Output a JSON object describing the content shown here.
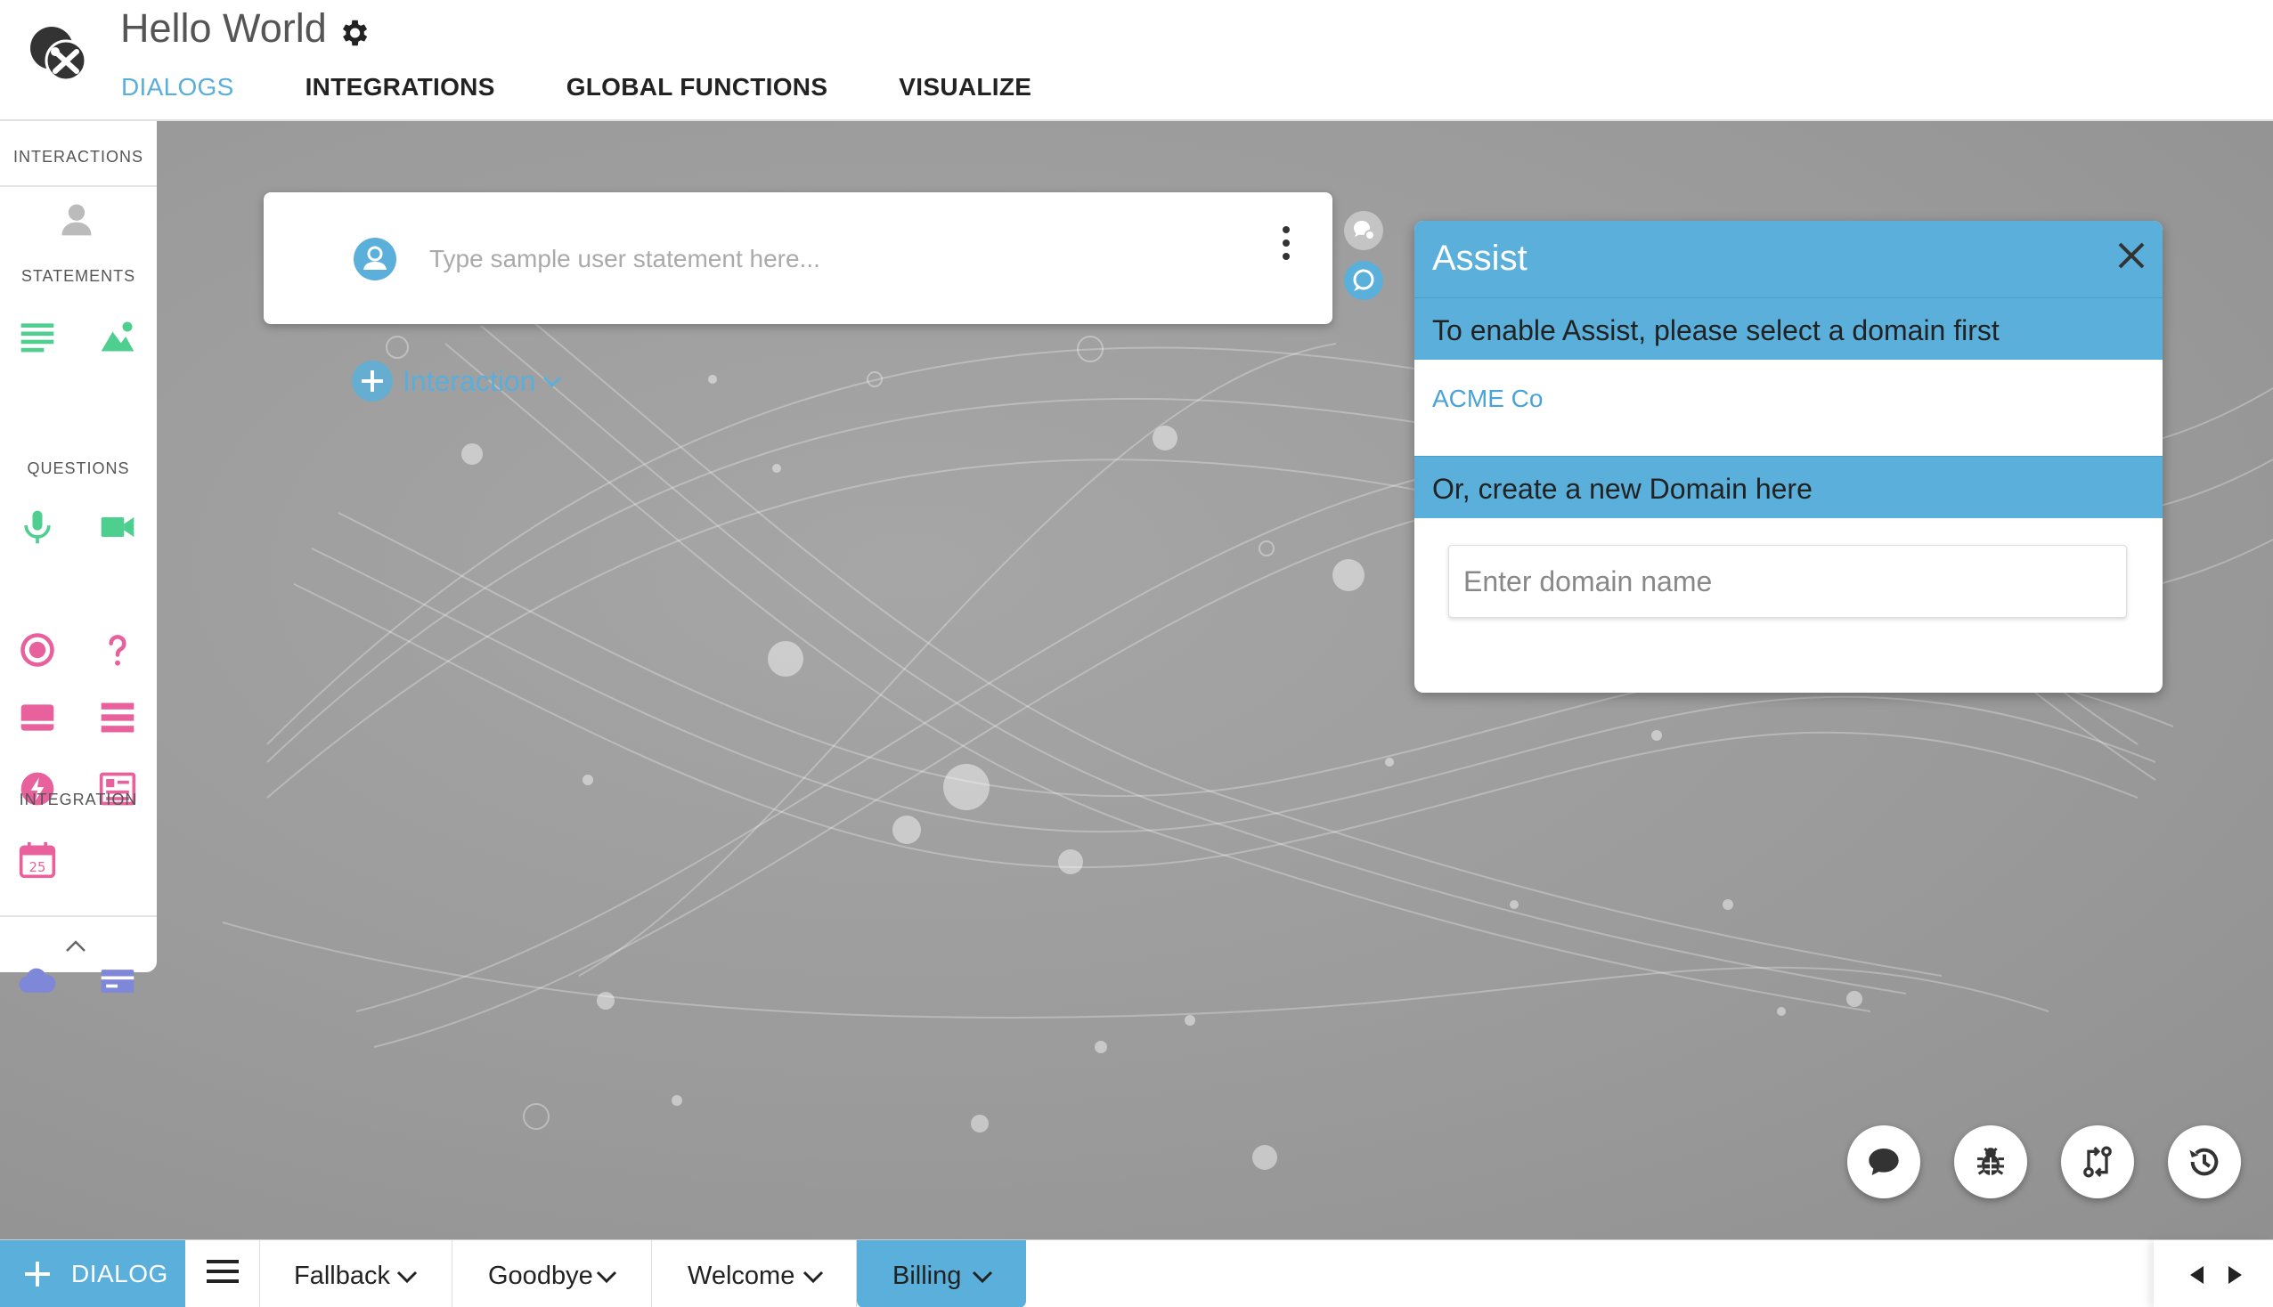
{
  "header": {
    "title": "Hello World",
    "tabs": [
      {
        "label": "DIALOGS",
        "active": true
      },
      {
        "label": "INTEGRATIONS",
        "active": false
      },
      {
        "label": "GLOBAL FUNCTIONS",
        "active": false
      },
      {
        "label": "VISUALIZE",
        "active": false
      }
    ]
  },
  "palette": {
    "sections": {
      "interactions": "INTERACTIONS",
      "statements": "STATEMENTS",
      "questions": "QUESTIONS",
      "integration": "INTEGRATION"
    },
    "calendar_day": "25"
  },
  "editor": {
    "statement_placeholder": "Type sample user statement here...",
    "add_interaction_label": "Interaction"
  },
  "assist": {
    "title": "Assist",
    "prompt": "To enable Assist, please select a domain first",
    "domains": [
      "ACME Co"
    ],
    "create_prompt": "Or, create a new Domain here",
    "domain_placeholder": "Enter domain name"
  },
  "bottom_bar": {
    "add_dialog_label": "DIALOG",
    "dialog_tabs": [
      {
        "label": "Fallback",
        "active": false
      },
      {
        "label": "Goodbye",
        "active": false
      },
      {
        "label": "Welcome",
        "active": false
      },
      {
        "label": "Billing",
        "active": true
      }
    ]
  },
  "colors": {
    "accent": "#5ab0db",
    "statement_green": "#4fcf8f",
    "question_pink": "#e8609c",
    "integration_purple": "#7f87d8"
  }
}
